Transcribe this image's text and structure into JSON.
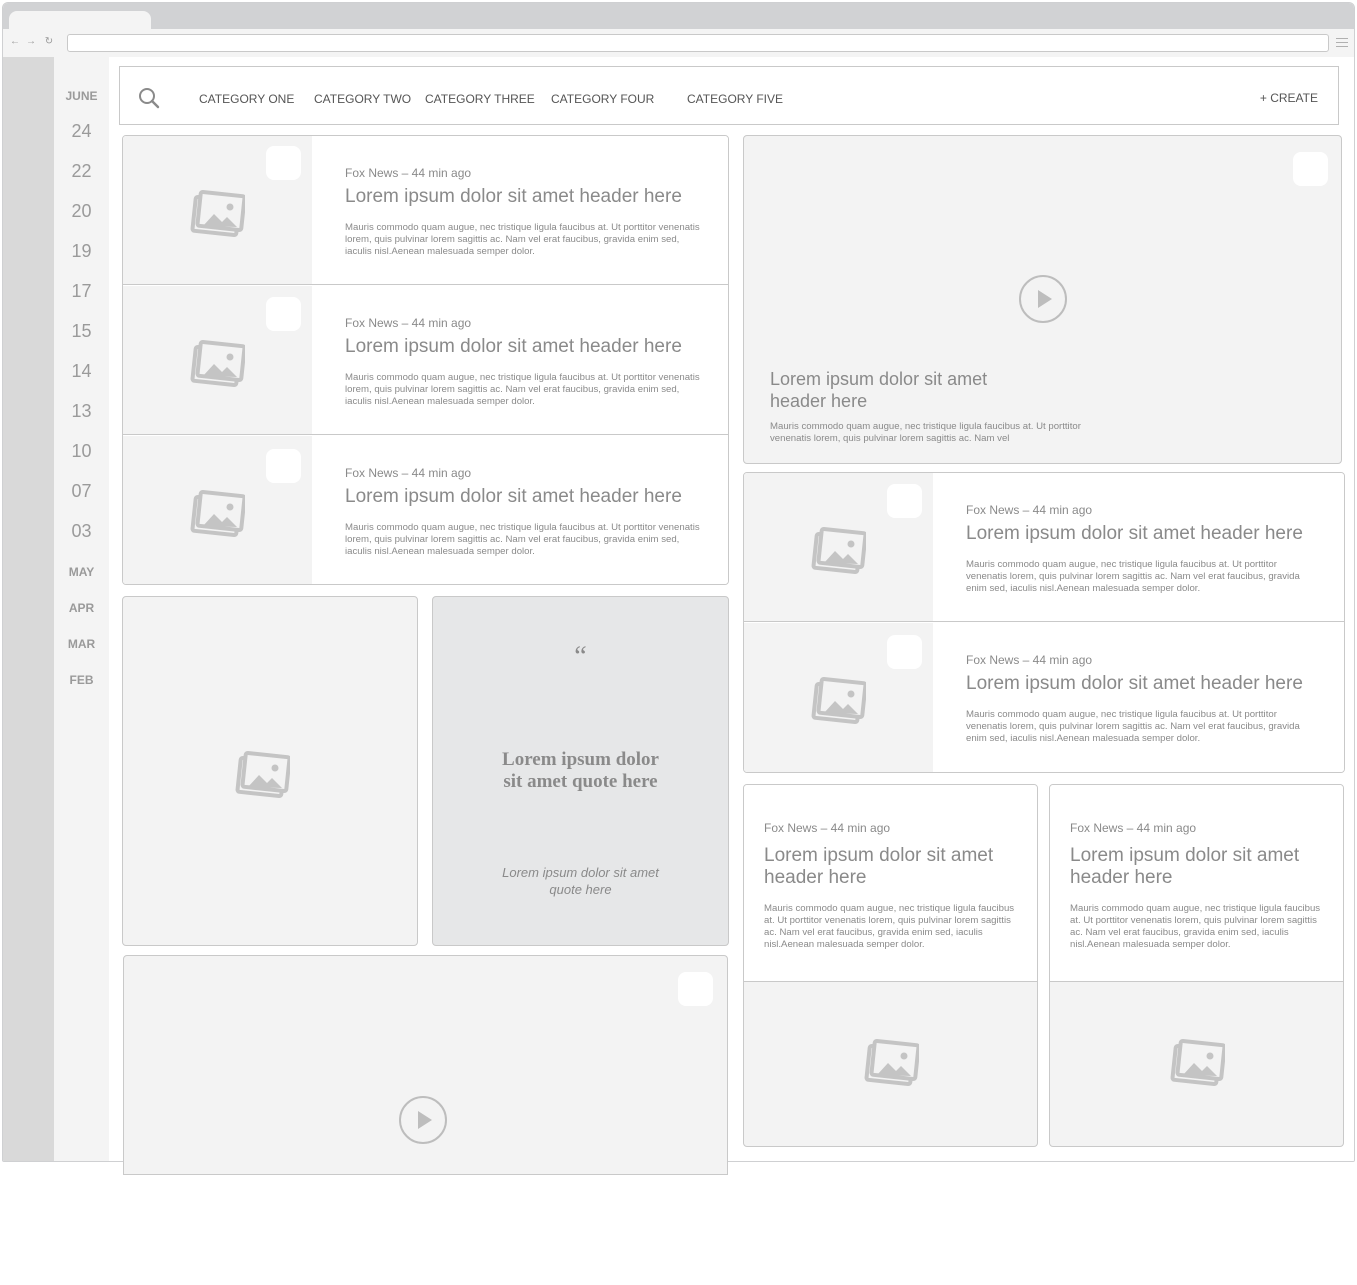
{
  "sidebar": {
    "dates": [
      {
        "label": "JUNE",
        "kind": "month"
      },
      {
        "label": "24",
        "kind": "day"
      },
      {
        "label": "22",
        "kind": "day"
      },
      {
        "label": "20",
        "kind": "day"
      },
      {
        "label": "19",
        "kind": "day"
      },
      {
        "label": "17",
        "kind": "day"
      },
      {
        "label": "15",
        "kind": "day"
      },
      {
        "label": "14",
        "kind": "day"
      },
      {
        "label": "13",
        "kind": "day"
      },
      {
        "label": "10",
        "kind": "day"
      },
      {
        "label": "07",
        "kind": "day"
      },
      {
        "label": "03",
        "kind": "day"
      },
      {
        "label": "MAY",
        "kind": "month"
      },
      {
        "label": "APR",
        "kind": "month"
      },
      {
        "label": "MAR",
        "kind": "month"
      },
      {
        "label": "FEB",
        "kind": "month"
      }
    ]
  },
  "nav": {
    "categories": [
      "CATEGORY ONE",
      "CATEGORY TWO",
      "CATEGORY THREE",
      "CATEGORY FOUR",
      "CATEGORY FIVE"
    ],
    "create_label": "+ CREATE"
  },
  "left_list": [
    {
      "meta": "Fox News – 44 min ago",
      "headline": "Lorem ipsum dolor sit amet header here",
      "excerpt": "Mauris commodo quam augue, nec tristique ligula faucibus at. Ut porttitor venenatis lorem, quis pulvinar lorem sagittis ac. Nam vel erat faucibus,  gravida enim sed, iaculis nisl.Aenean malesuada semper dolor."
    },
    {
      "meta": "Fox News – 44 min ago",
      "headline": "Lorem ipsum dolor sit amet header here",
      "excerpt": "Mauris commodo quam augue, nec tristique ligula faucibus at. Ut porttitor venenatis lorem, quis pulvinar lorem sagittis ac. Nam vel erat faucibus,  gravida enim sed, iaculis nisl.Aenean malesuada semper dolor."
    },
    {
      "meta": "Fox News – 44 min ago",
      "headline": "Lorem ipsum dolor sit amet header here",
      "excerpt": "Mauris commodo quam augue, nec tristique ligula faucibus at. Ut porttitor venenatis lorem, quis pulvinar lorem sagittis ac. Nam vel erat faucibus, gravida enim sed, iaculis nisl.Aenean malesuada semper dolor."
    }
  ],
  "video_feature": {
    "headline": "Lorem ipsum dolor sit amet header here",
    "excerpt": "Mauris commodo quam augue, nec tristique ligula faucibus at. Ut porttitor venenatis lorem, quis pulvinar lorem sagittis ac. Nam vel"
  },
  "right_list": [
    {
      "meta": "Fox News – 44 min ago",
      "headline": "Lorem ipsum dolor sit amet header here",
      "excerpt": "Mauris commodo quam augue, nec tristique ligula faucibus at. Ut porttitor venenatis lorem, quis pulvinar lorem sagittis ac. Nam vel erat faucibus,  gravida enim sed, iaculis nisl.Aenean malesuada semper dolor."
    },
    {
      "meta": "Fox News – 44 min ago",
      "headline": "Lorem ipsum dolor sit amet header here",
      "excerpt": "Mauris commodo quam augue, nec tristique ligula faucibus at. Ut porttitor venenatis lorem, quis pulvinar lorem sagittis ac. Nam vel erat faucibus,  gravida enim sed, iaculis nisl.Aenean malesuada semper dolor."
    }
  ],
  "quote": {
    "mark": "“",
    "main": "Lorem ipsum dolor sit amet quote here",
    "sub": "Lorem ipsum dolor sit amet quote here"
  },
  "tiles": [
    {
      "meta": "Fox News – 44 min ago",
      "headline": "Lorem ipsum dolor sit amet header here",
      "excerpt": "Mauris commodo quam augue, nec tristique ligula faucibus at. Ut porttitor venenatis lorem, quis pulvinar lorem sagittis ac. Nam vel erat faucibus, gravida enim sed, iaculis nisl.Aenean malesuada semper dolor."
    },
    {
      "meta": "Fox News – 44 min ago",
      "headline": "Lorem ipsum dolor sit amet header here",
      "excerpt": "Mauris commodo quam augue, nec tristique ligula faucibus at. Ut porttitor venenatis lorem, quis pulvinar lorem sagittis ac. Nam vel erat faucibus, gravida enim sed, iaculis nisl.Aenean malesuada semper dolor."
    }
  ],
  "icons": {
    "search": "search-icon",
    "image": "image-placeholder-icon",
    "play": "play-icon",
    "menu": "hamburger-menu-icon",
    "back": "back-arrow-icon",
    "forward": "forward-arrow-icon",
    "reload": "reload-icon"
  }
}
